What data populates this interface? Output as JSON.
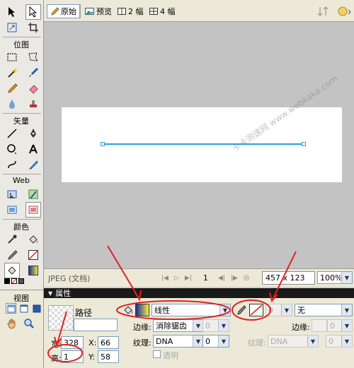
{
  "toolbox": {
    "section_bitmap": "位图",
    "section_vector": "矢量",
    "section_web": "Web",
    "section_colors": "颜色",
    "section_view": "视图"
  },
  "doc_toolbar": {
    "tab_original": "原始",
    "tab_preview": "预览",
    "tab_2up": "2 幅",
    "tab_4up": "4 幅"
  },
  "status_bar": {
    "file_type": "JPEG (文档)",
    "frame_number": "1",
    "size": "457 x 123",
    "zoom": "100%"
  },
  "properties": {
    "header": "属性",
    "object_type": "路径",
    "width_label": "宽:",
    "width_value": "328",
    "height_label": "高:",
    "height_value": "1",
    "x_label": "X:",
    "x_value": "66",
    "y_label": "Y:",
    "y_value": "58",
    "fill_type": "线性",
    "edge_label": "边缘:",
    "edge_value": "消除锯齿",
    "edge_amount": "0",
    "texture_label": "纹理:",
    "texture_value": "DNA",
    "texture_amount": "0",
    "transparent_label": "透明",
    "stroke_tip_size": "0",
    "stroke_category": "无",
    "stroke_edge_label": "边缘:",
    "stroke_edge_value": "0",
    "stroke_texture_label": "纹理:",
    "stroke_texture_value": "DNA",
    "stroke_texture_amount": "0"
  },
  "watermark": {
    "text": "卡卡测速网  www.webkaka.com"
  },
  "colors": {
    "annotation_red": "#e02020",
    "line_blue": "#2aa0e0",
    "toolbar_bg": "#ece9d8",
    "workspace_gray": "#c3c3c3"
  }
}
